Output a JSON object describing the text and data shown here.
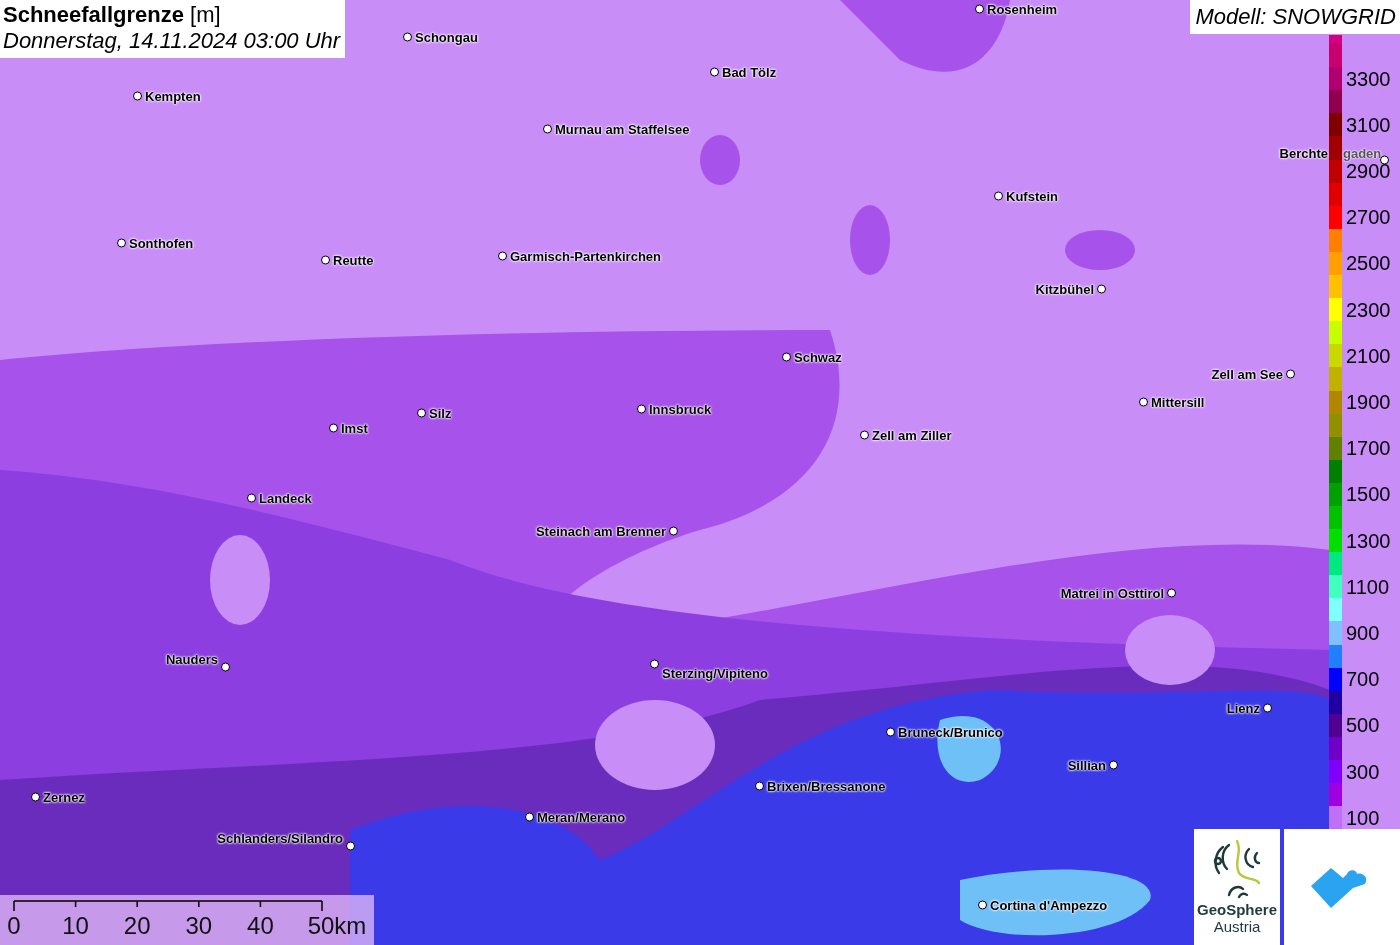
{
  "title": {
    "name": "Schneefallgrenze",
    "unit": "[m]",
    "datetime": "Donnerstag, 14.11.2024 03:00 Uhr"
  },
  "model": "Modell: SNOWGRID",
  "map": {
    "kind": "picture",
    "places": [
      {
        "name": "Schongau"
      },
      {
        "name": "Rosenheim"
      },
      {
        "name": "Kempten"
      },
      {
        "name": "Bad Tölz"
      },
      {
        "name": "Murnau am Staffelsee"
      },
      {
        "name": "Berchte",
        "name_rest": "gaden"
      },
      {
        "name": "Kufstein"
      },
      {
        "name": "Sonthofen"
      },
      {
        "name": "Reutte"
      },
      {
        "name": "Garmisch-Partenkirchen"
      },
      {
        "name": "Kitzbühel"
      },
      {
        "name": "Schwaz"
      },
      {
        "name": "Zell am See"
      },
      {
        "name": "Mittersill"
      },
      {
        "name": "Silz"
      },
      {
        "name": "Innsbruck"
      },
      {
        "name": "Imst"
      },
      {
        "name": "Zell am Ziller"
      },
      {
        "name": "Landeck"
      },
      {
        "name": "Steinach am Brenner"
      },
      {
        "name": "Matrei in Osttirol"
      },
      {
        "name": "Nauders"
      },
      {
        "name": "Sterzing/Vipiteno"
      },
      {
        "name": "Lienz"
      },
      {
        "name": "Bruneck/Brunico"
      },
      {
        "name": "Sillian"
      },
      {
        "name": "Brixen/Bressanone"
      },
      {
        "name": "Zernez"
      },
      {
        "name": "Meran/Merano"
      },
      {
        "name": "Schlanders/Silandro"
      },
      {
        "name": "Cortina d'Ampezzo"
      }
    ]
  },
  "legend": [
    {
      "color": "#d00080"
    },
    {
      "color": "#c80070"
    },
    {
      "color": "#b00070",
      "label": "3300"
    },
    {
      "color": "#900050"
    },
    {
      "color": "#800000",
      "label": "3100"
    },
    {
      "color": "#a00000"
    },
    {
      "color": "#c00000",
      "label": "2900"
    },
    {
      "color": "#e00000"
    },
    {
      "color": "#ff0000",
      "label": "2700"
    },
    {
      "color": "#ff8000"
    },
    {
      "color": "#ffa000",
      "label": "2500"
    },
    {
      "color": "#ffc000"
    },
    {
      "color": "#ffff00",
      "label": "2300"
    },
    {
      "color": "#c8ff00"
    },
    {
      "color": "#c8d800",
      "label": "2100"
    },
    {
      "color": "#c0b000"
    },
    {
      "color": "#b08800",
      "label": "1900"
    },
    {
      "color": "#909000"
    },
    {
      "color": "#608000",
      "label": "1700"
    },
    {
      "color": "#008000"
    },
    {
      "color": "#00a000",
      "label": "1500"
    },
    {
      "color": "#00c000"
    },
    {
      "color": "#00e000",
      "label": "1300"
    },
    {
      "color": "#00e880"
    },
    {
      "color": "#40ffc0",
      "label": "1100"
    },
    {
      "color": "#80ffff"
    },
    {
      "color": "#80c0ff",
      "label": "900"
    },
    {
      "color": "#2080ff"
    },
    {
      "color": "#0000ff",
      "label": "700"
    },
    {
      "color": "#2000a0"
    },
    {
      "color": "#500090",
      "label": "500"
    },
    {
      "color": "#7000c8"
    },
    {
      "color": "#8000ff",
      "label": "300"
    },
    {
      "color": "#a000e0"
    },
    {
      "color": "#c070f8",
      "label": "100"
    }
  ],
  "scale": [
    "0",
    "10",
    "20",
    "30",
    "40",
    "50km"
  ],
  "logos": {
    "geosphere": [
      "GeoSphere",
      "Austria"
    ]
  }
}
